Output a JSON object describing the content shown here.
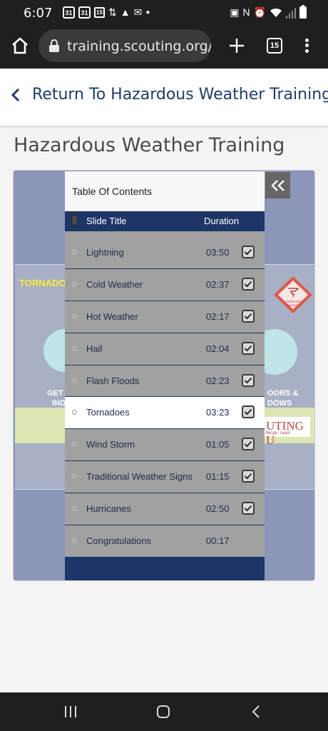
{
  "status_bar": {
    "time": "6:07",
    "calendar_badges": [
      "31",
      "31",
      "15"
    ]
  },
  "browser": {
    "url": "training.scouting.org/co",
    "tab_count": "15"
  },
  "return_link": {
    "label": "Return To Hazardous Weather Training"
  },
  "page_title": "Hazardous Weather Training",
  "slide": {
    "tornado_label": "TORNADO",
    "left_text_1": "GET",
    "left_text_2": "IND",
    "right_text_1": "OORS &",
    "right_text_2": "DOWS",
    "sign_line_1": "TORNADO",
    "sign_line_2": "WARNING",
    "badge_text": "UTING U",
    "badge_tagline": "llenge. Lead."
  },
  "toc": {
    "title": "Table Of Contents",
    "col_title": "Slide Title",
    "col_duration": "Duration",
    "rows": [
      {
        "title": "Lightning",
        "duration": "03:50",
        "checked": true,
        "active": false
      },
      {
        "title": "Cold Weather",
        "duration": "02:37",
        "checked": true,
        "active": false
      },
      {
        "title": "Hot Weather",
        "duration": "02:17",
        "checked": true,
        "active": false
      },
      {
        "title": "Hail",
        "duration": "02:04",
        "checked": true,
        "active": false
      },
      {
        "title": "Flash Floods",
        "duration": "02:23",
        "checked": true,
        "active": false
      },
      {
        "title": "Tornadoes",
        "duration": "03:23",
        "checked": true,
        "active": true
      },
      {
        "title": "Wind Storm",
        "duration": "01:05",
        "checked": true,
        "active": false
      },
      {
        "title": "Traditional Weather Signs",
        "duration": "01:15",
        "checked": true,
        "active": false
      },
      {
        "title": "Hurricanes",
        "duration": "02:50",
        "checked": true,
        "active": false
      },
      {
        "title": "Congratulations",
        "duration": "00:17",
        "checked": false,
        "active": false
      }
    ]
  },
  "colors": {
    "navy": "#1d3667",
    "link_blue": "#1d3c6e",
    "row_gray": "#a1a1a1",
    "active_row": "#ffffff"
  },
  "icons": {
    "home": "home-icon",
    "lock": "lock-icon",
    "new_tab": "plus-icon",
    "tabs": "tab-switcher-icon",
    "menu": "overflow-menu-icon",
    "return": "chevron-left-icon",
    "collapse": "double-chevron-left-icon",
    "bookmark": "bookmark-icon",
    "check": "checkbox-checked-icon"
  }
}
